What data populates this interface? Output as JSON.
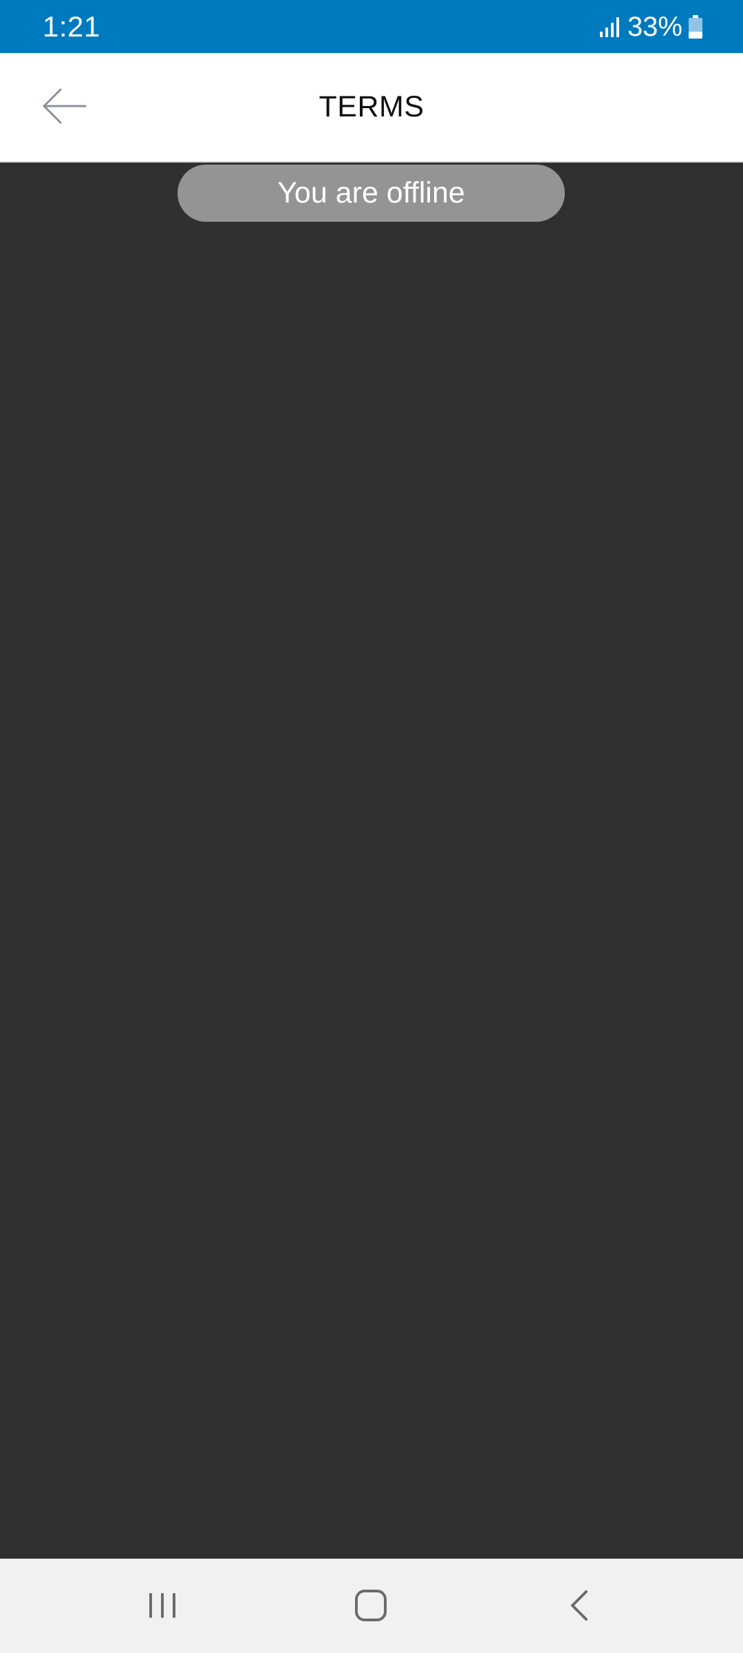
{
  "status_bar": {
    "time": "1:21",
    "battery_percent": "33%",
    "battery_level": 0.33,
    "signal_icon": "signal-bars-icon",
    "battery_icon": "battery-icon",
    "background_color": "#007ABF"
  },
  "header": {
    "title": "TERMS",
    "back_icon": "arrow-left-icon"
  },
  "content": {
    "offline_message": "You are offline",
    "background_color": "#303030"
  },
  "nav_bar": {
    "recents_icon": "recents-icon",
    "home_icon": "home-icon",
    "back_icon": "chevron-left-icon"
  }
}
